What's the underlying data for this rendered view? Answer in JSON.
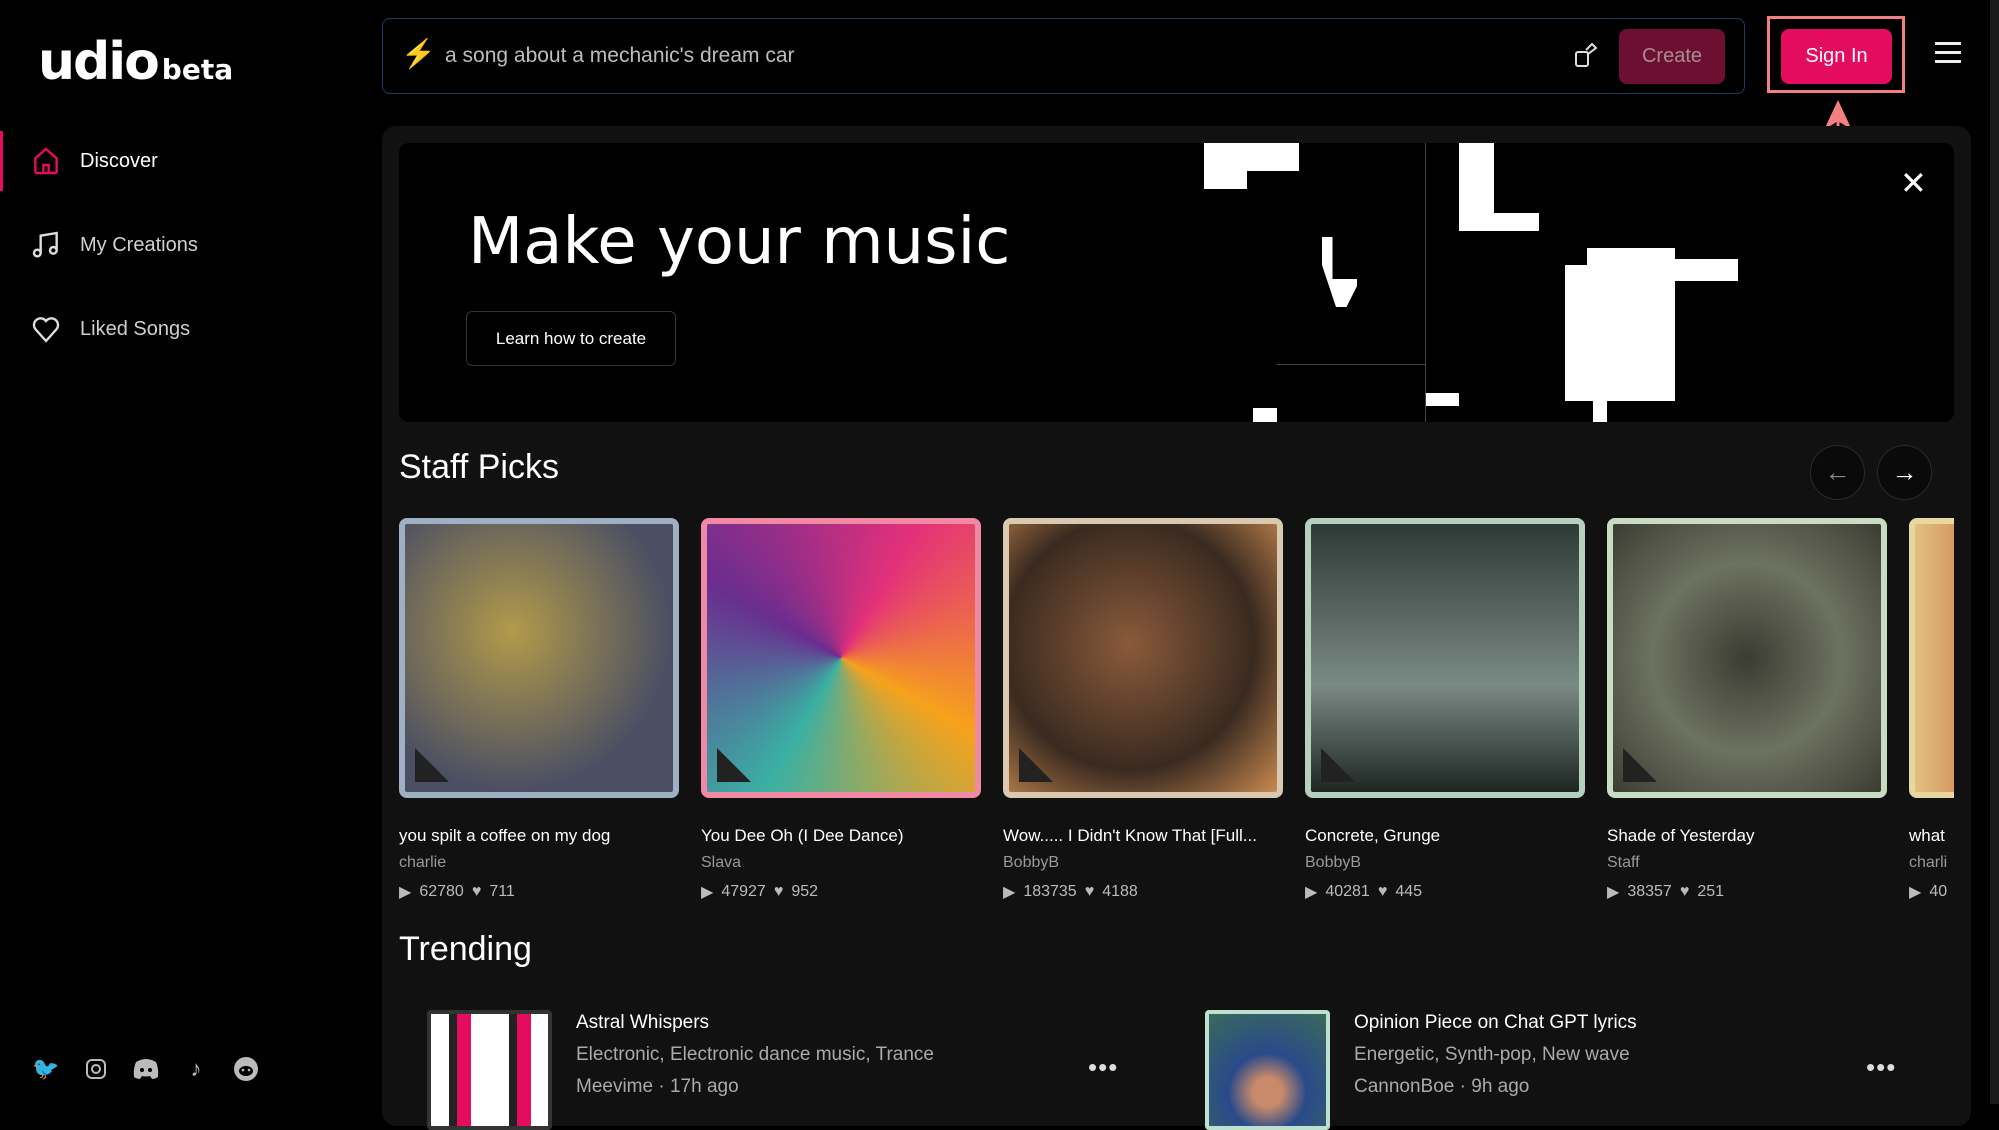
{
  "brand": {
    "name": "udio",
    "tag": "beta"
  },
  "sidebar": {
    "items": [
      {
        "label": "Discover",
        "icon": "home-icon",
        "active": true
      },
      {
        "label": "My Creations",
        "icon": "music-note-icon"
      },
      {
        "label": "Liked Songs",
        "icon": "heart-icon"
      }
    ],
    "social": [
      "twitter-icon",
      "instagram-icon",
      "discord-icon",
      "tiktok-icon",
      "reddit-icon"
    ]
  },
  "header": {
    "search_placeholder": "a song about a mechanic's dream car",
    "create_label": "Create",
    "signin_label": "Sign In"
  },
  "banner": {
    "title": "Make your music",
    "button": "Learn how to create"
  },
  "staff_picks": {
    "title": "Staff Picks",
    "cards": [
      {
        "title": "you spilt a coffee on my dog",
        "artist": "charlie",
        "plays": "62780",
        "likes": "711"
      },
      {
        "title": "You Dee Oh (I Dee Dance)",
        "artist": "Slava",
        "plays": "47927",
        "likes": "952"
      },
      {
        "title": "Wow..... I Didn't Know That [Full...",
        "artist": "BobbyB",
        "plays": "183735",
        "likes": "4188"
      },
      {
        "title": "Concrete, Grunge",
        "artist": "BobbyB",
        "plays": "40281",
        "likes": "445"
      },
      {
        "title": "Shade of Yesterday",
        "artist": "Staff",
        "plays": "38357",
        "likes": "251"
      },
      {
        "title": "what",
        "artist": "charli",
        "plays": "40",
        "likes": ""
      }
    ]
  },
  "trending": {
    "title": "Trending",
    "items": [
      {
        "title": "Astral Whispers",
        "genres": "Electronic, Electronic dance music, Trance",
        "author": "Meevime",
        "time": "17h ago"
      },
      {
        "title": "Opinion Piece on Chat GPT lyrics",
        "genres": "Energetic, Synth-pop, New wave",
        "author": "CannonBoe",
        "time": "9h ago"
      }
    ]
  },
  "colors": {
    "accent": "#e30c5f",
    "highlight": "#f28080"
  }
}
